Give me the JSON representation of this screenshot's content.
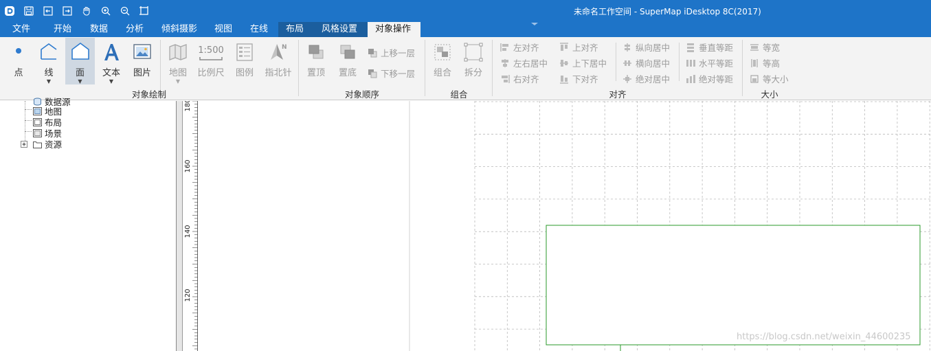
{
  "window": {
    "title": "未命名工作空间 - SuperMap iDesktop 8C(2017)"
  },
  "quick_access": [
    "app-logo-icon",
    "save-icon",
    "import-icon",
    "export-icon",
    "pan-hand-icon",
    "zoom-in-icon",
    "zoom-out-icon",
    "full-extent-icon"
  ],
  "tabs": [
    {
      "label": "文件"
    },
    {
      "label": "开始"
    },
    {
      "label": "数据"
    },
    {
      "label": "分析"
    },
    {
      "label": "倾斜摄影"
    },
    {
      "label": "视图"
    },
    {
      "label": "在线"
    },
    {
      "label": "布局"
    },
    {
      "label": "风格设置"
    },
    {
      "label": "对象操作"
    }
  ],
  "ribbon": {
    "draw": {
      "label": "对象绘制",
      "point": "点",
      "line": "线",
      "polygon": "面",
      "text": "文本",
      "image": "图片",
      "map": "地图",
      "scale": "比例尺",
      "legend": "图例",
      "north": "指北针",
      "scale_icon_text": "1:500"
    },
    "order": {
      "label": "对象顺序",
      "top": "置顶",
      "bottom": "置底",
      "up": "上移一层",
      "down": "下移一层"
    },
    "group": {
      "label": "组合",
      "group": "组合",
      "ungroup": "拆分"
    },
    "align": {
      "label": "对齐",
      "left": "左对齐",
      "center_h": "左右居中",
      "right": "右对齐",
      "top": "上对齐",
      "center_v": "上下居中",
      "bottom": "下对齐",
      "vertical_center": "纵向居中",
      "horizontal_center": "横向居中",
      "absolute_center": "绝对居中",
      "v_equal_space": "垂直等距",
      "h_equal_space": "水平等距",
      "abs_equal_space": "绝对等距"
    },
    "size": {
      "label": "大小",
      "same_width": "等宽",
      "same_height": "等高",
      "same_size": "等大小"
    }
  },
  "tree": {
    "items": [
      {
        "label": "数据源"
      },
      {
        "label": "地图"
      },
      {
        "label": "布局"
      },
      {
        "label": "场景"
      },
      {
        "label": "资源"
      }
    ],
    "expander": "+"
  },
  "ruler": {
    "ticks": [
      "180",
      "160",
      "140",
      "120"
    ]
  },
  "watermark": "https://blog.csdn.net/weixin_44600235",
  "colors": {
    "title_bar": "#1e74c8",
    "active_tab": "#f3f3f3",
    "ribbon": "#f3f3f3",
    "rect_outline": "#2a9a2a"
  }
}
